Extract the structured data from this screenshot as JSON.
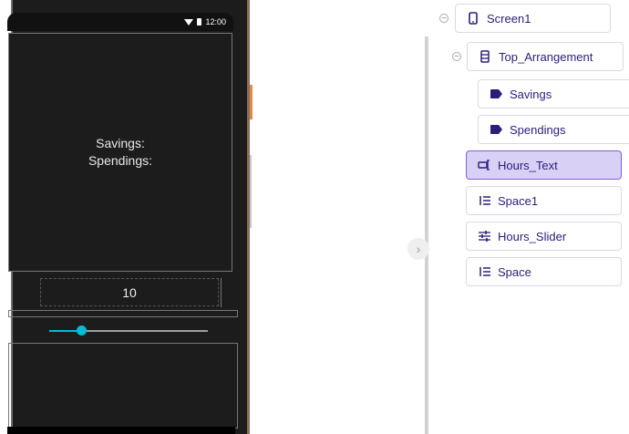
{
  "phone": {
    "status_time": "12:00",
    "savings_label": "Savings:",
    "spendings_label": "Spendings:",
    "hours_value": "10",
    "slider_fraction": 0.2
  },
  "tree": {
    "nodes": [
      {
        "label": "Screen1",
        "icon": "phone-icon"
      },
      {
        "label": "Top_Arrangement",
        "icon": "vertical-arrangement-icon"
      },
      {
        "label": "Savings",
        "icon": "label-icon"
      },
      {
        "label": "Spendings",
        "icon": "label-icon"
      },
      {
        "label": "Hours_Text",
        "icon": "textbox-icon"
      },
      {
        "label": "Space1",
        "icon": "space-icon"
      },
      {
        "label": "Hours_Slider",
        "icon": "slider-icon"
      },
      {
        "label": "Space",
        "icon": "space-icon"
      }
    ],
    "selected": "Hours_Text"
  },
  "colors": {
    "accent": "#00bcd4",
    "tree_text": "#2b1d7a",
    "selected_bg": "#d8d0f5"
  }
}
